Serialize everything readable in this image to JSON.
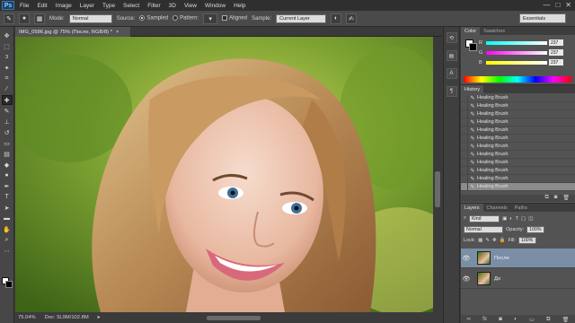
{
  "app": {
    "logo": "Ps"
  },
  "menu": [
    "File",
    "Edit",
    "Image",
    "Layer",
    "Type",
    "Select",
    "Filter",
    "3D",
    "View",
    "Window",
    "Help"
  ],
  "window_controls": [
    "—",
    "□",
    "✕"
  ],
  "options": {
    "mode_label": "Mode:",
    "mode_value": "Normal",
    "source_label": "Source:",
    "sampled_label": "Sampled",
    "pattern_label": "Pattern:",
    "aligned_label": "Aligned",
    "sample_label": "Sample:",
    "sample_value": "Current Layer",
    "workspace": "Essentials"
  },
  "document": {
    "tab_title": "IMG_0586.jpg @ 75% (После, RGB/8) *",
    "zoom": "75.04%",
    "doc_size": "Doc: 5L9M/102.8M"
  },
  "color_panel": {
    "tabs": [
      "Color",
      "Swatches"
    ],
    "channels": [
      {
        "name": "R",
        "value": "237",
        "gradient": "linear-gradient(90deg,#00ffff,#ffffff)"
      },
      {
        "name": "G",
        "value": "237",
        "gradient": "linear-gradient(90deg,#ff00ff,#ffffff)"
      },
      {
        "name": "B",
        "value": "237",
        "gradient": "linear-gradient(90deg,#ffff00,#ffffff)"
      }
    ]
  },
  "history_panel": {
    "tab": "History",
    "items": [
      "Healing Brush",
      "Healing Brush",
      "Healing Brush",
      "Healing Brush",
      "Healing Brush",
      "Healing Brush",
      "Healing Brush",
      "Healing Brush",
      "Healing Brush",
      "Healing Brush",
      "Healing Brush",
      "Healing Brush"
    ],
    "selected_index": 11
  },
  "layers_panel": {
    "tabs": [
      "Layers",
      "Channels",
      "Paths"
    ],
    "kind": "Kind",
    "blend_mode": "Normal",
    "opacity_label": "Opacity:",
    "opacity_value": "100%",
    "lock_label": "Lock:",
    "fill_label": "Fill:",
    "fill_value": "100%",
    "layers": [
      {
        "name": "После",
        "selected": true
      },
      {
        "name": "До",
        "selected": false
      }
    ]
  },
  "colors": {
    "accent_selected_layer": "#7a8ea6",
    "panel_bg": "#535353"
  }
}
